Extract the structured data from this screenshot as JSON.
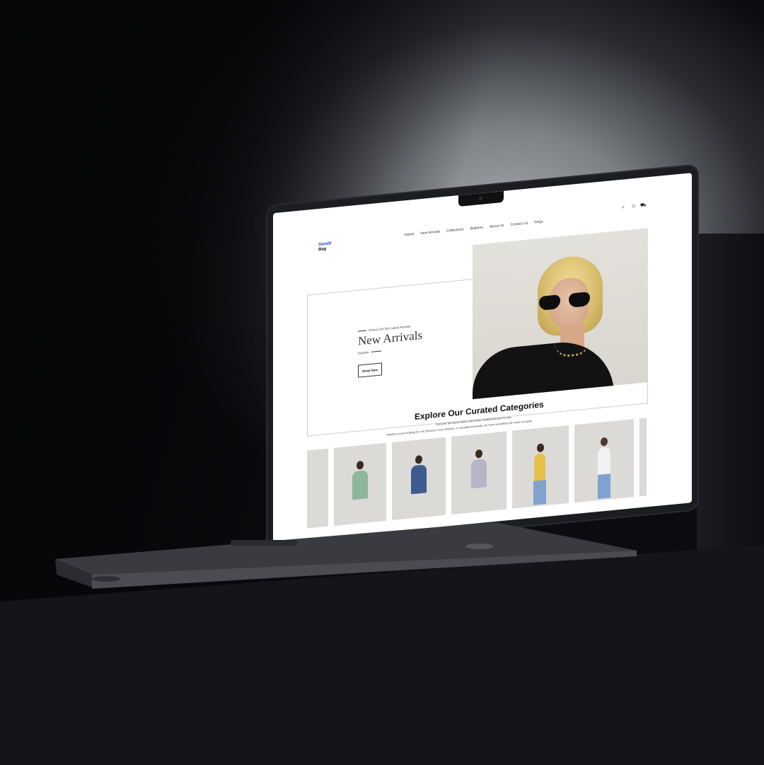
{
  "site": {
    "logo": {
      "line1": "Sandd",
      "line2": "Bag"
    },
    "nav": [
      "Home",
      "New Arrivals",
      "Collections",
      "Bottoms",
      "About Us",
      "Contact Us",
      "FAQs"
    ],
    "icons": [
      "search-icon",
      "account-icon",
      "cart-icon"
    ]
  },
  "hero": {
    "eyebrow": "Check Out Our Latest Arrivals",
    "title": "New Arrivals",
    "explore": "Explore",
    "button": "Shop Now"
  },
  "categories": {
    "title": "Explore Our Curated Categories",
    "subtitle_line1": "Discover the latest styles and trends handpicked just for you.",
    "subtitle_line2": "Whether you're looking for chic dresses, cozy rompers, or versatile jumpsuits, we have something for every occasion.",
    "cards": [
      {
        "name": "card-1",
        "color": "#8fb59a"
      },
      {
        "name": "card-2",
        "color": "#8fb59a"
      },
      {
        "name": "card-3",
        "color": "#3f5a8c"
      },
      {
        "name": "card-4",
        "color": "#b7b3c8"
      },
      {
        "name": "card-5",
        "color": "#e6c04a"
      },
      {
        "name": "card-6",
        "color": "#f2f2f2"
      }
    ]
  },
  "colors": {
    "brand": "#1a3bd6",
    "text": "#111111",
    "device": "#1c1d21"
  }
}
